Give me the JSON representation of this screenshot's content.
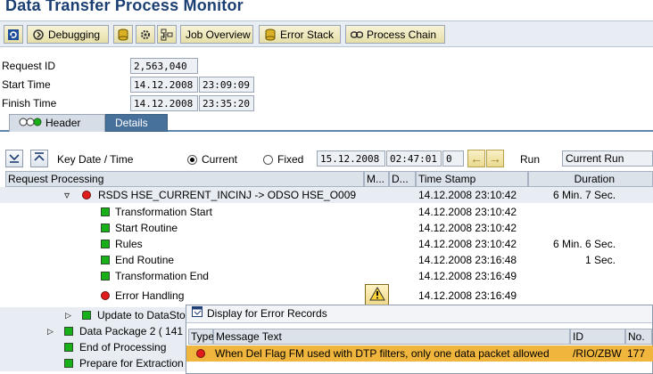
{
  "window": {
    "title": "Data Transfer Process Monitor"
  },
  "toolbar": {
    "debugging": "Debugging",
    "job_overview": "Job Overview",
    "error_stack": "Error Stack",
    "process_chain": "Process Chain"
  },
  "header_fields": {
    "request_id_label": "Request ID",
    "request_id": "2,563,040",
    "start_time_label": "Start Time",
    "start_date": "14.12.2008",
    "start_time": "23:09:09",
    "finish_time_label": "Finish Time",
    "finish_date": "14.12.2008",
    "finish_time": "23:35:20"
  },
  "tabs": [
    {
      "label": "Header"
    },
    {
      "label": "Details"
    }
  ],
  "keydate": {
    "label": "Key Date / Time",
    "current": "Current",
    "fixed": "Fixed",
    "date": "15.12.2008",
    "time": "02:47:01",
    "counter": "0",
    "run_label": "Run",
    "run_value": "Current Run"
  },
  "table": {
    "columns": [
      "Request Processing",
      "M...",
      "D...",
      "Time Stamp",
      "Duration"
    ],
    "rows": [
      {
        "text": "RSDS  HSE_CURRENT_INCINJ -> ODSO HSE_O009",
        "status": "red",
        "timestamp": "14.12.2008 23:10:42",
        "duration": "6 Min. 7 Sec."
      },
      {
        "text": "Transformation Start",
        "status": "green",
        "timestamp": "14.12.2008 23:10:42",
        "duration": ""
      },
      {
        "text": "Start Routine",
        "status": "green",
        "timestamp": "14.12.2008 23:10:42",
        "duration": ""
      },
      {
        "text": "Rules",
        "status": "green",
        "timestamp": "14.12.2008 23:10:42",
        "duration": "6 Min. 6 Sec."
      },
      {
        "text": "End Routine",
        "status": "green",
        "timestamp": "14.12.2008 23:16:48",
        "duration": "1 Sec."
      },
      {
        "text": "Transformation End",
        "status": "green",
        "timestamp": "14.12.2008 23:16:49",
        "duration": ""
      },
      {
        "text": "Error Handling",
        "status": "red",
        "timestamp": "14.12.2008 23:16:49",
        "duration": ""
      },
      {
        "text": "Update to DataSto",
        "status": "green",
        "timestamp": "",
        "duration": ""
      },
      {
        "text": "Data Package 2 ( 141",
        "status": "green",
        "timestamp": "",
        "duration": ""
      },
      {
        "text": "End of Processing",
        "status": "green",
        "timestamp": "",
        "duration": ""
      },
      {
        "text": "Prepare for Extraction",
        "status": "green",
        "timestamp": "",
        "duration": ""
      }
    ]
  },
  "popup": {
    "title": "Display for Error Records",
    "columns": [
      "Type",
      "Message Text",
      "ID",
      "No."
    ],
    "row": {
      "message": "When Del Flag FM used with DTP filters, only one data packet allowed",
      "id": "/RIO/ZBW",
      "no": "177"
    }
  },
  "colors": {
    "title": "#1b3f73",
    "accent": "#47709a",
    "error": "#e21c1c",
    "ok": "#18b018",
    "highlight": "#f0b53c"
  }
}
